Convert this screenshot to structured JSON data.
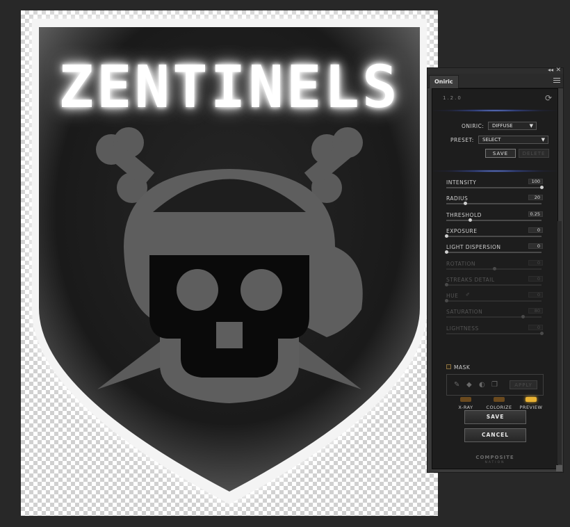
{
  "canvas": {
    "title": "ZENTINELS"
  },
  "panel": {
    "tab_label": "Oniric",
    "collapse_glyph": "◂◂",
    "close_glyph": "✕",
    "version": "1.2.0",
    "oniric_label": "ONIRIC:",
    "oniric_value": "DIFFUSE",
    "preset_label": "PRESET:",
    "preset_value": "SELECT",
    "save_preset_label": "SAVE",
    "delete_preset_label": "DELETE",
    "sliders": [
      {
        "name": "INTENSITY",
        "value": "100",
        "position": 1.0,
        "enabled": true
      },
      {
        "name": "RADIUS",
        "value": "20",
        "position": 0.2,
        "enabled": true
      },
      {
        "name": "THRESHOLD",
        "value": "0.25",
        "position": 0.25,
        "enabled": true
      },
      {
        "name": "EXPOSURE",
        "value": "0",
        "position": 0.0,
        "enabled": true
      },
      {
        "name": "LIGHT DISPERSION",
        "value": "0",
        "position": 0.0,
        "enabled": true
      },
      {
        "name": "ROTATION",
        "value": "0",
        "position": 0.5,
        "enabled": false
      },
      {
        "name": "STREAKS DETAIL",
        "value": "0",
        "position": 0.0,
        "enabled": false
      },
      {
        "name": "HUE",
        "value": "0",
        "position": 0.0,
        "enabled": false
      },
      {
        "name": "SATURATION",
        "value": "80",
        "position": 0.8,
        "enabled": false
      },
      {
        "name": "LIGHTNESS",
        "value": "0",
        "position": 1.0,
        "enabled": false
      }
    ],
    "mask_label": "MASK",
    "apply_label": "APPLY",
    "toggles": [
      {
        "label": "X-RAY",
        "on": false
      },
      {
        "label": "COLORIZE",
        "on": false
      },
      {
        "label": "PREVIEW",
        "on": true
      }
    ],
    "save_label": "SAVE",
    "cancel_label": "CANCEL",
    "brand_line1": "COMPOSITE",
    "brand_line2": "NATION"
  },
  "colors": {
    "toggle_on": "#e9b233",
    "toggle_off": "#6b4a1e",
    "glow": "#7a96ff"
  }
}
